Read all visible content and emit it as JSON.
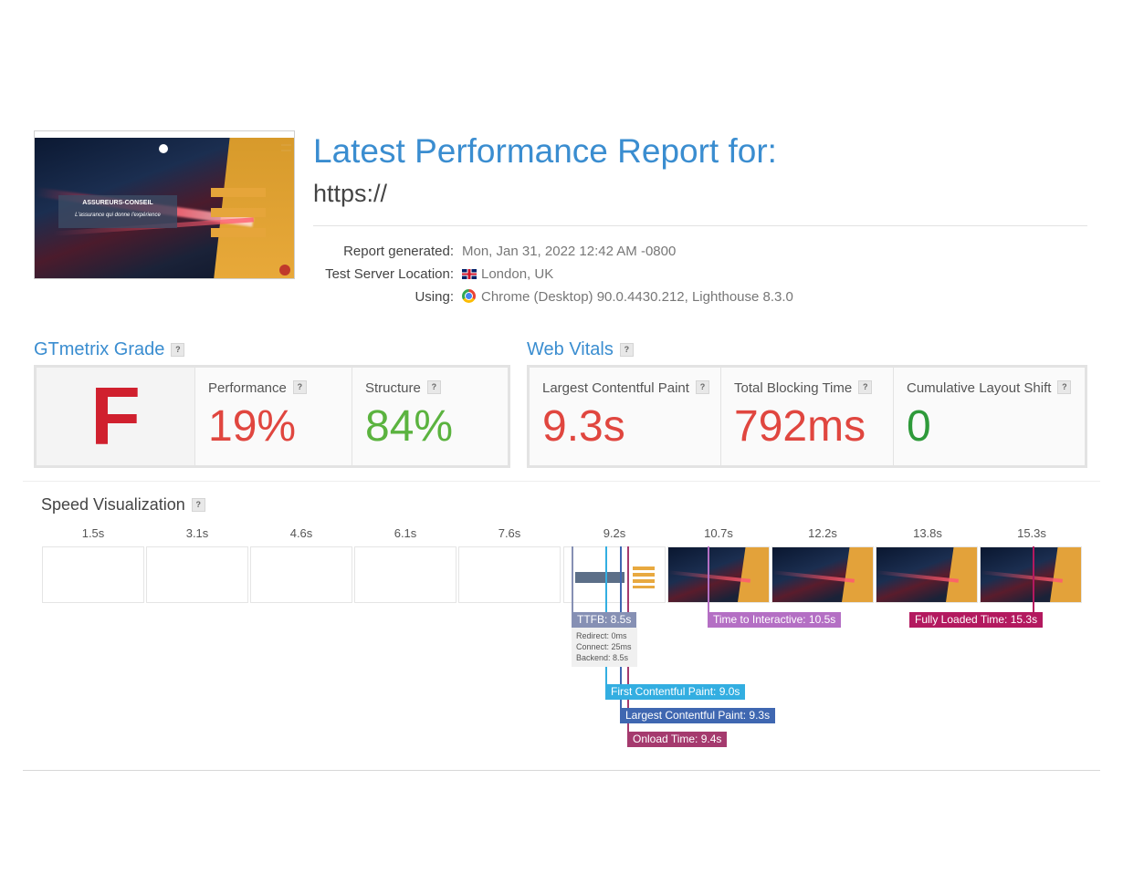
{
  "header": {
    "title": "Latest Performance Report for:",
    "url": "https://",
    "thumbnail": {
      "brand_title": "ASSUREURS-CONSEIL",
      "brand_subtitle": "L'assurance qui donne l'expérience",
      "buttons": [
        "",
        "",
        ""
      ]
    },
    "meta": [
      {
        "label": "Report generated:",
        "value": "Mon, Jan 31, 2022 12:42 AM -0800",
        "icon": ""
      },
      {
        "label": "Test Server Location:",
        "value": "London, UK",
        "icon": "uk-flag-icon"
      },
      {
        "label": "Using:",
        "value": "Chrome (Desktop) 90.0.4430.212, Lighthouse 8.3.0",
        "icon": "chrome-icon"
      }
    ]
  },
  "grade": {
    "title": "GTmetrix Grade",
    "help": "?",
    "letter": "F",
    "performance_label": "Performance",
    "performance_value": "19%",
    "structure_label": "Structure",
    "structure_value": "84%"
  },
  "web_vitals": {
    "title": "Web Vitals",
    "help": "?",
    "lcp_label": "Largest Contentful Paint",
    "lcp_value": "9.3s",
    "tbt_label": "Total Blocking Time",
    "tbt_value": "792ms",
    "cls_label": "Cumulative Layout Shift",
    "cls_value": "0"
  },
  "speed_visualization": {
    "title": "Speed Visualization",
    "help": "?",
    "times": [
      "1.5s",
      "3.1s",
      "4.6s",
      "6.1s",
      "7.6s",
      "9.2s",
      "10.7s",
      "12.2s",
      "13.8s",
      "15.3s"
    ],
    "frames": [
      "blank",
      "blank",
      "blank",
      "blank",
      "blank",
      "partial",
      "shot",
      "shot",
      "shot",
      "shot"
    ],
    "markers": {
      "ttfb": "TTFB: 8.5s",
      "redirect": "Redirect: 0ms",
      "connect": "Connect: 25ms",
      "backend": "Backend: 8.5s",
      "tti": "Time to Interactive: 10.5s",
      "fully_loaded": "Fully Loaded Time: 15.3s",
      "fcp": "First Contentful Paint: 9.0s",
      "lcp": "Largest Contentful Paint: 9.3s",
      "onload": "Onload Time: 9.4s"
    }
  },
  "colors": {
    "accent_blue": "#3a8dd0",
    "grade_red": "#d0202e",
    "bad_red": "#e0463f",
    "good_green": "#5bb33f",
    "cls_green": "#2e9a3a",
    "ttfb": "#8690b4",
    "tti": "#b46fc4",
    "fully_loaded": "#b3195f",
    "fcp": "#33aee1",
    "lcp": "#3f67b1",
    "onload": "#a53a6e"
  }
}
